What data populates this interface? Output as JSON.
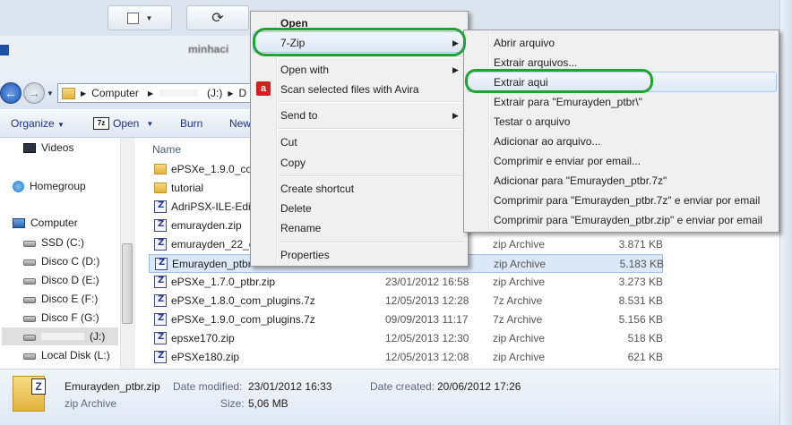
{
  "top_toolbar": {
    "refresh_icon": "refresh-icon"
  },
  "window_title": "minhaci",
  "address_bar": {
    "crumbs": [
      "Computer",
      "(J:)",
      "D"
    ]
  },
  "toolbar": {
    "organize": "Organize",
    "open": "Open",
    "burn": "Burn",
    "new_folder": "New"
  },
  "nav": {
    "videos": "Videos",
    "homegroup": "Homegroup",
    "computer": "Computer",
    "drives": [
      "SSD (C:)",
      "Disco C (D:)",
      "Disco D (E:)",
      "Disco E (F:)",
      "Disco F (G:)",
      "(J:)",
      "Local Disk (L:)"
    ]
  },
  "file_list": {
    "name_header": "Name",
    "rows": [
      {
        "name": "ePSXe_1.9.0_com",
        "date": "",
        "type": "",
        "size": "",
        "icon": "folder"
      },
      {
        "name": "tutorial",
        "date": "",
        "type": "",
        "size": "",
        "icon": "folder"
      },
      {
        "name": "AdriPSX-ILE-Edit",
        "date": "",
        "type": "",
        "size": "",
        "icon": "zip"
      },
      {
        "name": "emurayden.zip",
        "date": "",
        "type": "",
        "size": "",
        "icon": "zip"
      },
      {
        "name": "emurayden_22_e",
        "date": "",
        "type": "zip Archive",
        "size": "3.871 KB",
        "icon": "zip"
      },
      {
        "name": "Emurayden_ptbr",
        "date": "",
        "type": "zip Archive",
        "size": "5.183 KB",
        "icon": "zip"
      },
      {
        "name": "ePSXe_1.7.0_ptbr.zip",
        "date": "23/01/2012 16:58",
        "type": "zip Archive",
        "size": "3.273 KB",
        "icon": "zip"
      },
      {
        "name": "ePSXe_1.8.0_com_plugins.7z",
        "date": "12/05/2013 12:28",
        "type": "7z Archive",
        "size": "8.531 KB",
        "icon": "zip"
      },
      {
        "name": "ePSXe_1.9.0_com_plugins.7z",
        "date": "09/09/2013 11:17",
        "type": "7z Archive",
        "size": "5.156 KB",
        "icon": "zip"
      },
      {
        "name": "epsxe170.zip",
        "date": "12/05/2013 12:30",
        "type": "zip Archive",
        "size": "518 KB",
        "icon": "zip"
      },
      {
        "name": "ePSXe180.zip",
        "date": "12/05/2013 12:08",
        "type": "zip Archive",
        "size": "621 KB",
        "icon": "zip"
      }
    ]
  },
  "details": {
    "filename": "Emurayden_ptbr.zip",
    "type": "zip Archive",
    "modified_label": "Date modified:",
    "modified": "23/01/2012 16:33",
    "size_label": "Size:",
    "size": "5,06 MB",
    "created_label": "Date created:",
    "created": "20/06/2012 17:26"
  },
  "context_menu": {
    "items": [
      "Open",
      "7-Zip",
      "Open with",
      "Scan selected files with Avira",
      "Send to",
      "Cut",
      "Copy",
      "Create shortcut",
      "Delete",
      "Rename",
      "Properties"
    ]
  },
  "submenu": {
    "items": [
      "Abrir arquivo",
      "Extrair arquivos...",
      "Extrair aqui",
      "Extrair para \"Emurayden_ptbr\\\"",
      "Testar o arquivo",
      "Adicionar ao arquivo...",
      "Comprimir e enviar por email...",
      "Adicionar para \"Emurayden_ptbr.7z\"",
      "Comprimir para \"Emurayden_ptbr.7z\" e enviar por email",
      "Comprimir para \"Emurayden_ptbr.zip\" e enviar por email"
    ]
  },
  "colors": {
    "highlight_oval": "#21a331",
    "avira": "#d71e1e",
    "selection": "#dbe8f8"
  }
}
